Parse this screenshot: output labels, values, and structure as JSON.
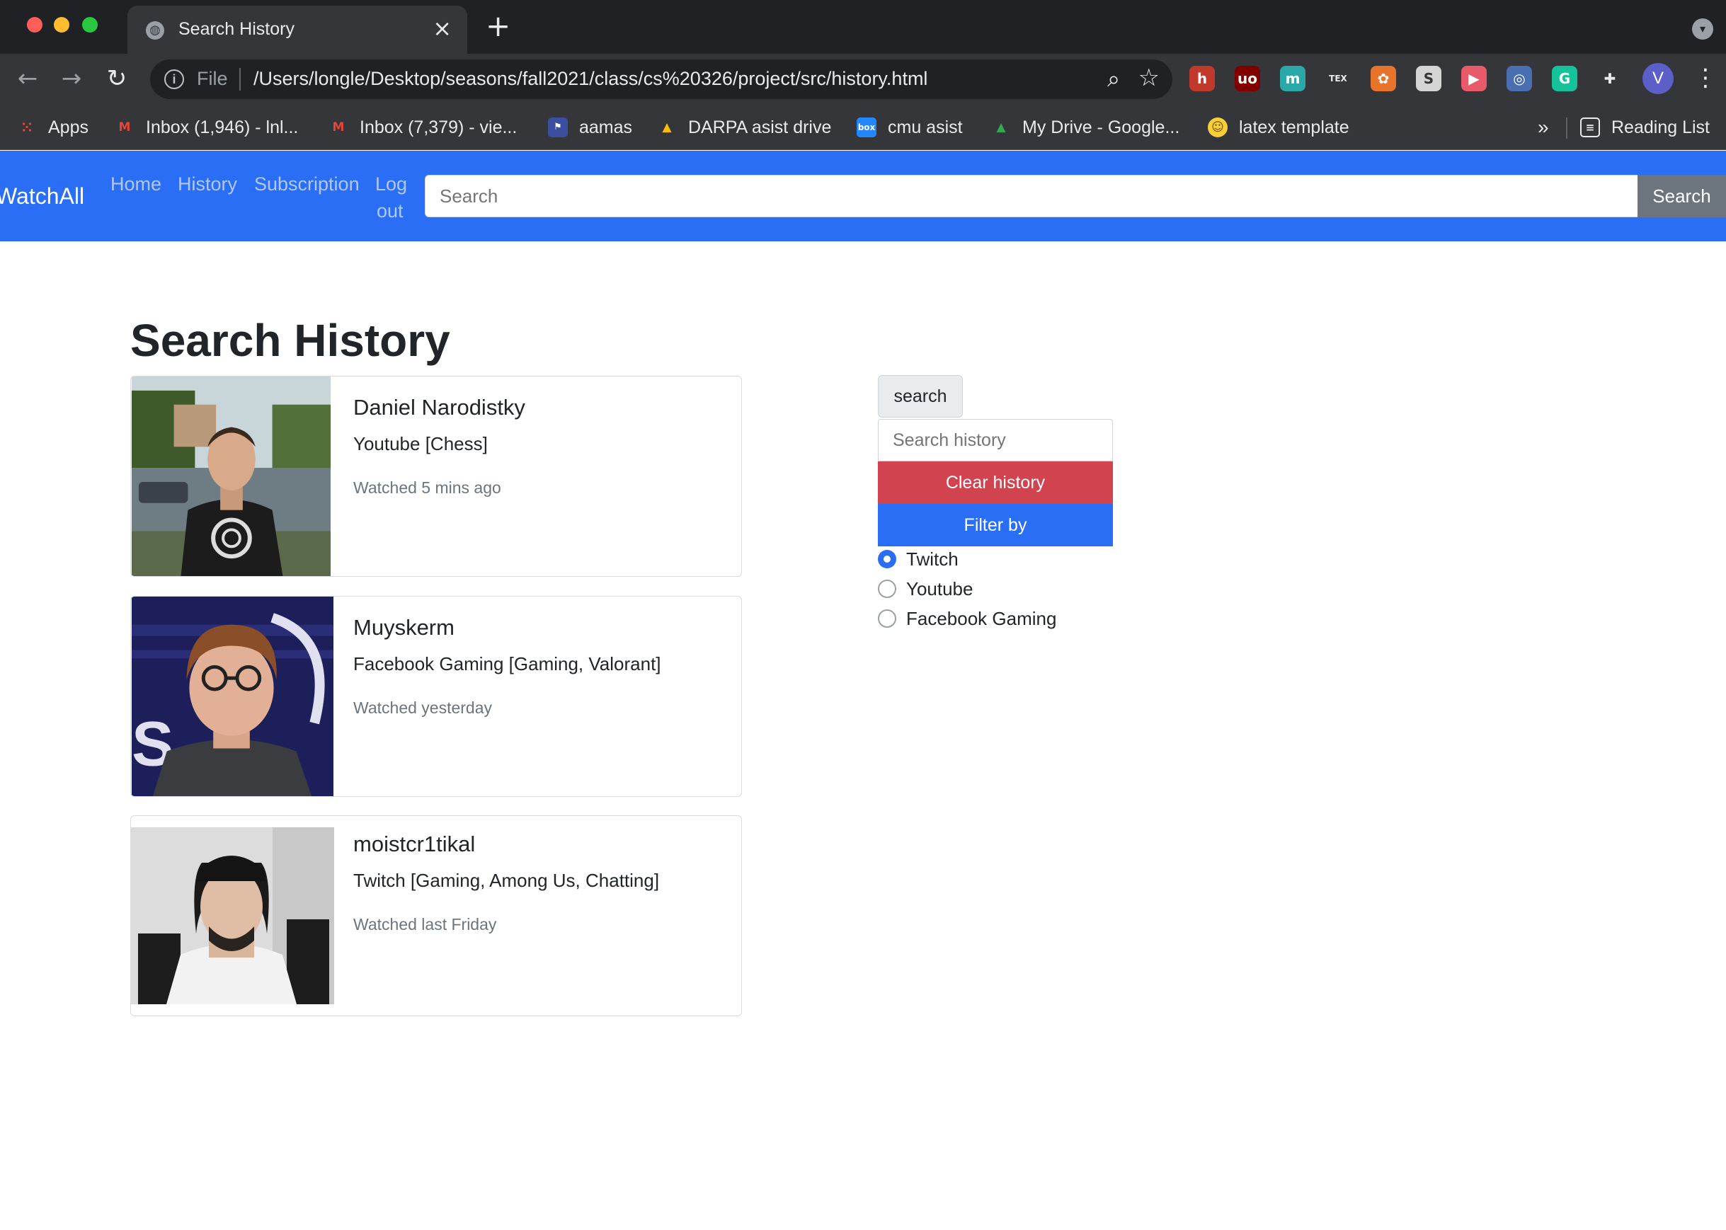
{
  "browser": {
    "tab_title": "Search History",
    "url_scheme": "File",
    "url": "/Users/longle/Desktop/seasons/fall2021/class/cs%20326/project/src/history.html",
    "extensions": [
      {
        "name": "hypothesis-icon",
        "glyph": "h",
        "color": "#c0392b"
      },
      {
        "name": "ublock-icon",
        "glyph": "uo",
        "color": "#800000"
      },
      {
        "name": "m-extension-icon",
        "glyph": "m",
        "color": "#2aa8a8"
      },
      {
        "name": "tex-icon",
        "glyph": "TEX",
        "color": "#35363a"
      },
      {
        "name": "sprout-icon",
        "glyph": "✿",
        "color": "#e8732a"
      },
      {
        "name": "s-extension-icon",
        "glyph": "S",
        "color": "#d5d5d5"
      },
      {
        "name": "video-icon",
        "glyph": "▶",
        "color": "#e85a6a"
      },
      {
        "name": "glasses-icon",
        "glyph": "◎",
        "color": "#4a6fb0"
      },
      {
        "name": "grammarly-icon",
        "glyph": "G",
        "color": "#15c39a"
      },
      {
        "name": "puzzle-icon",
        "glyph": "✚",
        "color": "#35363a"
      }
    ],
    "profile_initial": "V",
    "bookmarks": [
      {
        "label": "Apps",
        "icon": "apps-grid-icon"
      },
      {
        "label": "Inbox (1,946) - lnl...",
        "icon": "gmail-icon"
      },
      {
        "label": "Inbox (7,379) - vie...",
        "icon": "gmail-icon"
      },
      {
        "label": "aamas",
        "icon": "aamas-icon"
      },
      {
        "label": "DARPA asist drive",
        "icon": "drive-icon"
      },
      {
        "label": "cmu asist",
        "icon": "box-icon"
      },
      {
        "label": "My Drive - Google...",
        "icon": "drive-icon"
      },
      {
        "label": "latex template",
        "icon": "emoji-icon"
      }
    ],
    "more_label": "»",
    "reading_list": "Reading List"
  },
  "navbar": {
    "brand": "WatchAll",
    "links": [
      "Home",
      "History",
      "Subscription",
      "Log",
      "out"
    ],
    "search_placeholder": "Search",
    "search_button": "Search"
  },
  "main": {
    "title": "Search History",
    "history": [
      {
        "name": "Daniel Narodistky",
        "platform": "Youtube [Chess]",
        "watched": "Watched 5 mins ago"
      },
      {
        "name": "Muyskerm",
        "platform": "Facebook Gaming [Gaming, Valorant]",
        "watched": "Watched yesterday"
      },
      {
        "name": "moistcr1tikal",
        "platform": "Twitch [Gaming, Among Us, Chatting]",
        "watched": "Watched last Friday"
      }
    ]
  },
  "sidebar": {
    "search_button": "search",
    "search_placeholder": "Search history",
    "clear_button": "Clear history",
    "filter_button": "Filter by",
    "filters": [
      {
        "label": "Twitch",
        "checked": true
      },
      {
        "label": "Youtube",
        "checked": false
      },
      {
        "label": "Facebook Gaming",
        "checked": false
      }
    ]
  },
  "colors": {
    "navbar": "#2b6ef6",
    "clear_button": "#d1434f",
    "filter_button": "#2b6ef6",
    "search_button": "#6c757d"
  }
}
